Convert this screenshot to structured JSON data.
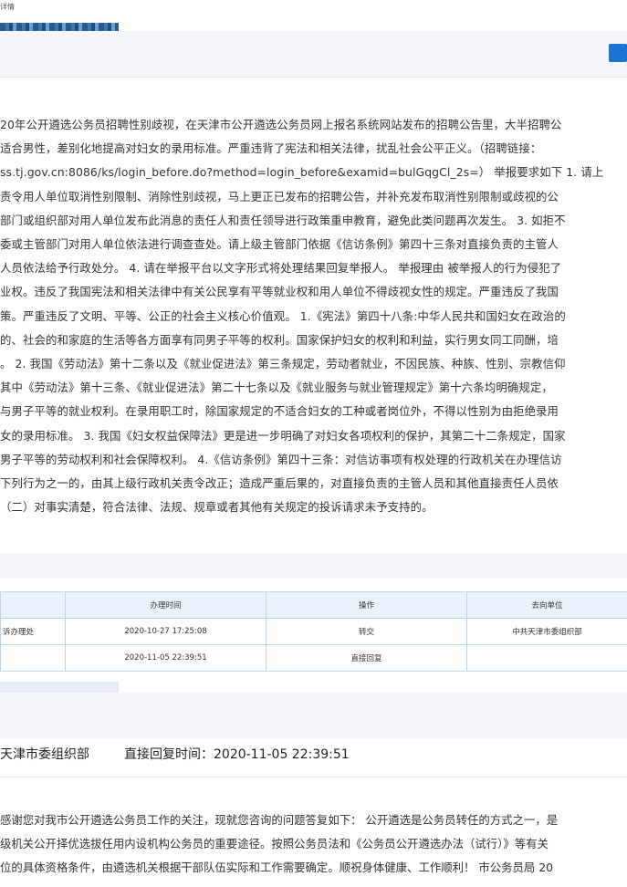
{
  "breadcrumb": "详情",
  "complaint": {
    "lines": [
      "20年公开遴选公务员招聘性别歧视，在天津市公开遴选公务员网上报名系统网站发布的招聘公告里，大半招聘公",
      "适合男性，差别化地提高对妇女的录用标准。严重违背了宪法和相关法律，扰乱社会公平正义。（招聘链接：",
      "ss.tj.gov.cn:8086/ks/login_before.do?method=login_before&examid=bulGqgCl_2s=）  举报要求如下 1. 请上",
      "责令用人单位取消性别限制、消除性别歧视，马上更正已发布的招聘公告，并补充发布取消性别限制或歧视的公",
      "部门或组织部对用人单位发布此消息的责任人和责任领导进行政策重申教育，避免此类问题再次发生。 3. 如拒不",
      "委或主管部门对用人单位依法进行调查查处。请上级主管部门依据《信访条例》第四十三条对直接负责的主管人",
      "人员依法给予行政处分。 4. 请在举报平台以文字形式将处理结果回复举报人。 举报理由 被举报人的行为侵犯了",
      "业权。违反了我国宪法和相关法律中有关公民享有平等就业权和用人单位不得歧视女性的规定。严重违反了我国",
      "策。严重违反了文明、平等、公正的社会主义核心价值观。 1.《宪法》第四十八条:中华人民共和国妇女在政治的",
      "的、社会的和家庭的生活等各方面享有同男子平等的权利。国家保护妇女的权利和利益，实行男女同工同酬，培",
      "。 2. 我国《劳动法》第十二条以及《就业促进法》第三条规定，劳动者就业，不因民族、种族、性别、宗教信仰",
      "其中《劳动法》第十三条、《就业促进法》第二十七条以及《就业服务与就业管理规定》第十六条均明确规定，",
      "与男子平等的就业权利。在录用职工时，除国家规定的不适合妇女的工种或者岗位外，不得以性别为由拒绝录用",
      "女的录用标准。 3. 我国《妇女权益保障法》更是进一步明确了对妇女各项权利的保护，其第二十二条规定，国家",
      "男子平等的劳动权利和社会保障权利。 4.《信访条例》第四十三条：对信访事项有权处理的行政机关在办理信访",
      "下列行为之一的，由其上级行政机关责令改正；造成严重后果的，对直接负责的主管人员和其他直接责任人员依",
      "（二）对事实清楚，符合法律、法规、规章或者其他有关规定的投诉请求未予支持的。"
    ]
  },
  "track_table": {
    "headers": [
      "",
      "办理时间",
      "操作",
      "去向单位"
    ],
    "rows": [
      [
        "诉办理处",
        "2020-10-27 17:25:08",
        "转交",
        "中共天津市委组织部"
      ],
      [
        "",
        "2020-11-05 22:39:51",
        "直接回复",
        ""
      ]
    ]
  },
  "reply": {
    "dept": "天津市委组织部",
    "time_label": "直接回复时间：",
    "time_value": "2020-11-05 22:39:51",
    "lines": [
      "感谢您对我市公开遴选公务员工作的关注，现就您咨询的问题答复如下： 公开遴选是公务员转任的方式之一，是",
      "级机关公开择优选拔任用内设机构公务员的重要途径。按照公务员法和《公务员公开遴选办法（试行）》等有关",
      "位的具体资格条件，由遴选机关根据干部队伍实际和工作需要确定。顺祝身体健康、工作顺利！ 市公务员局 20"
    ]
  },
  "colors": {
    "accent": "#1b73d3",
    "table_border": "#b7d6ef",
    "table_header_bg": "#eaf3fb",
    "section_bg": "#f5f6f9"
  }
}
